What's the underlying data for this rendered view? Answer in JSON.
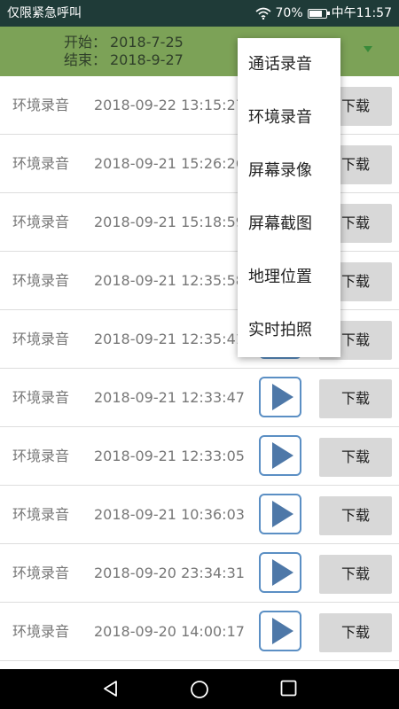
{
  "status_bar": {
    "notice": "仅限紧急呼叫",
    "battery": "70%",
    "time": "中午11:57"
  },
  "header": {
    "start_label": "开始：",
    "start_value": "2018-7-25",
    "end_label": "结束：",
    "end_value": "2018-9-27"
  },
  "menu": {
    "items": [
      "通话录音",
      "环境录音",
      "屏幕录像",
      "屏幕截图",
      "地理位置",
      "实时拍照"
    ]
  },
  "recordings": [
    {
      "type": "环境录音",
      "time": "2018-09-22 13:15:27",
      "download": "下载"
    },
    {
      "type": "环境录音",
      "time": "2018-09-21 15:26:26",
      "download": "下载"
    },
    {
      "type": "环境录音",
      "time": "2018-09-21 15:18:59",
      "download": "下载"
    },
    {
      "type": "环境录音",
      "time": "2018-09-21 12:35:58",
      "download": "下载"
    },
    {
      "type": "环境录音",
      "time": "2018-09-21 12:35:41",
      "download": "下载"
    },
    {
      "type": "环境录音",
      "time": "2018-09-21 12:33:47",
      "download": "下载"
    },
    {
      "type": "环境录音",
      "time": "2018-09-21 12:33:05",
      "download": "下载"
    },
    {
      "type": "环境录音",
      "time": "2018-09-21 10:36:03",
      "download": "下载"
    },
    {
      "type": "环境录音",
      "time": "2018-09-20 23:34:31",
      "download": "下载"
    },
    {
      "type": "环境录音",
      "time": "2018-09-20 14:00:17",
      "download": "下载"
    }
  ],
  "nav": {
    "icons": [
      "back-icon",
      "home-icon",
      "recents-icon"
    ]
  },
  "colors": {
    "header_bg": "#7ca257",
    "status_bg": "#1f3b38",
    "play_border": "#5b8fc4",
    "download_bg": "#d8d8d8"
  }
}
